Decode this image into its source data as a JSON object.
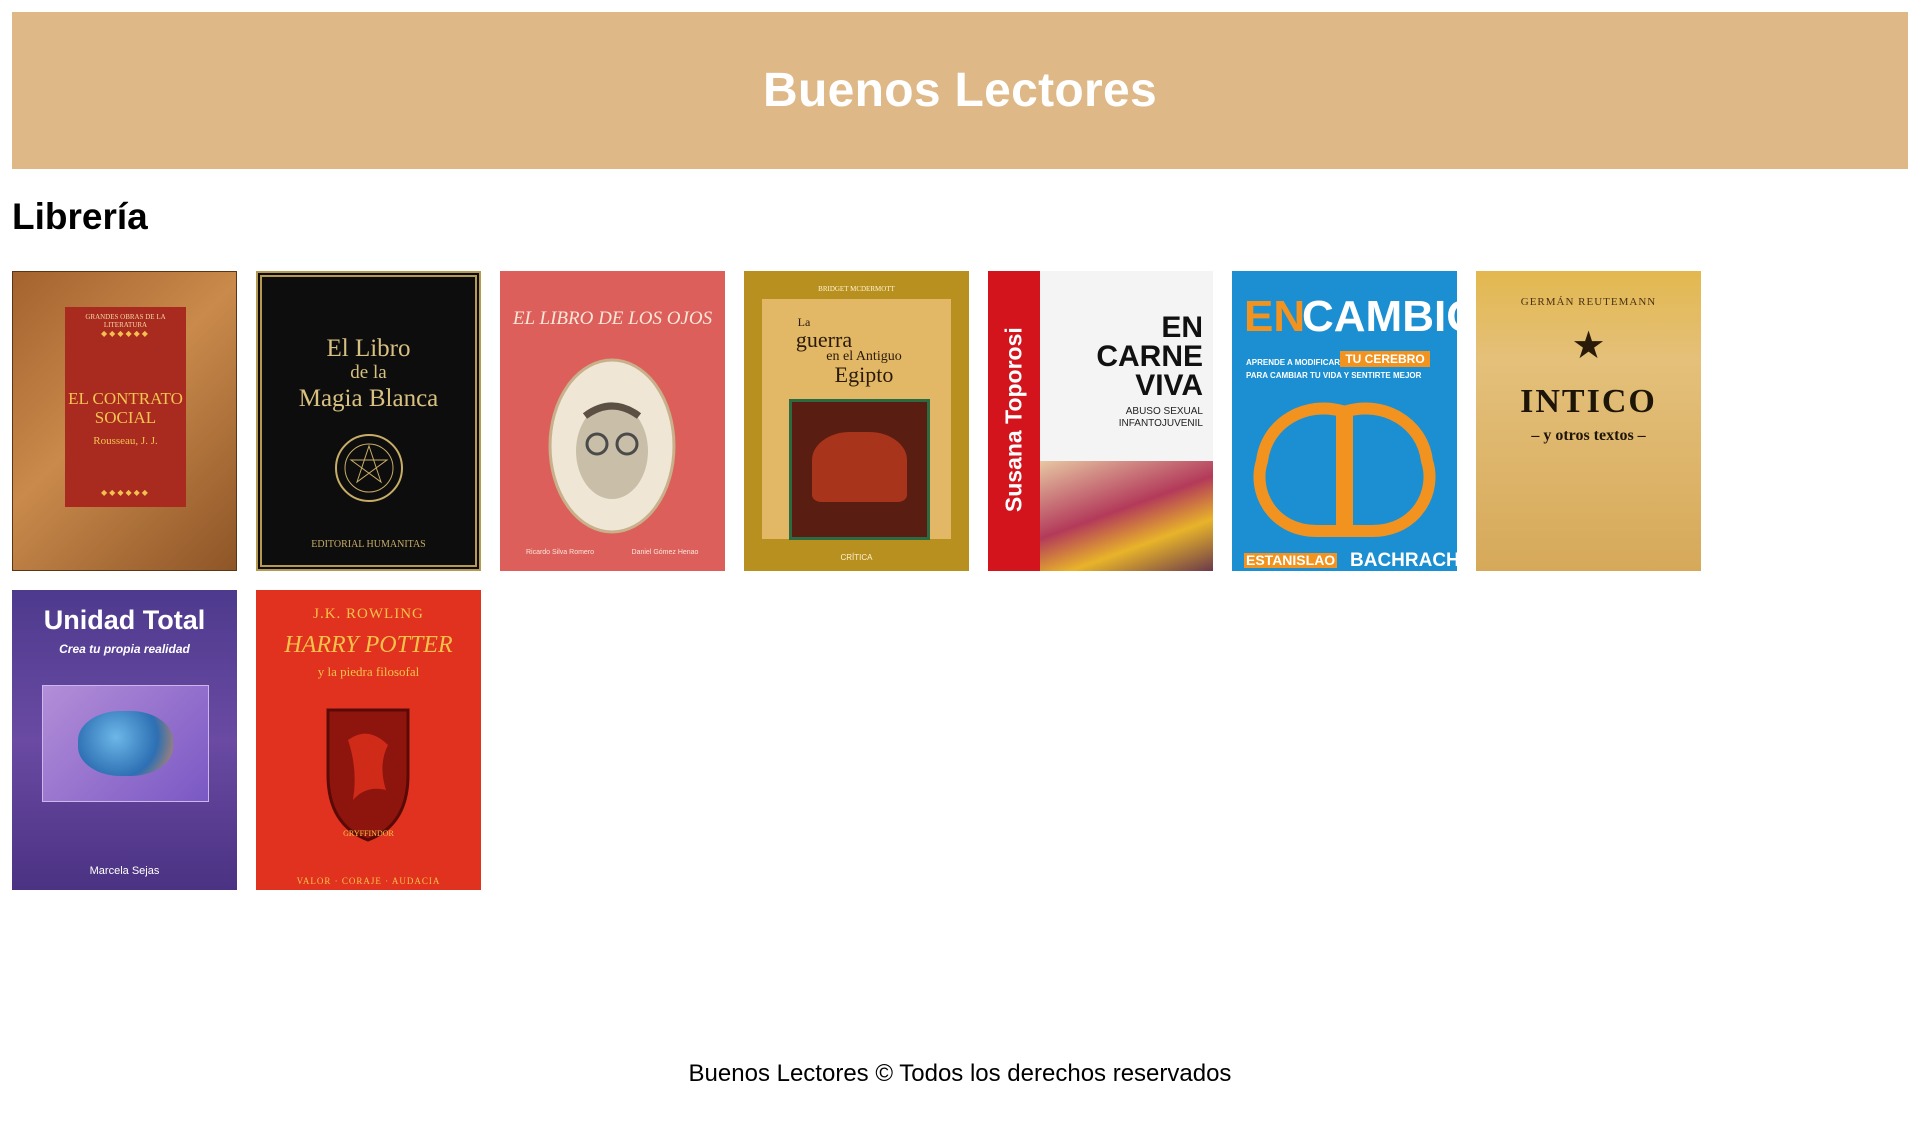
{
  "header": {
    "title": "Buenos Lectores"
  },
  "section": {
    "title": "Librería"
  },
  "books": [
    {
      "series": "GRANDES OBRAS DE LA LITERATURA",
      "title_line1": "EL CONTRATO",
      "title_line2": "SOCIAL",
      "author": "Rousseau, J. J."
    },
    {
      "title_line1": "El Libro",
      "title_line2": "de la",
      "title_line3": "Magia Blanca",
      "publisher": "EDITORIAL HUMANITAS"
    },
    {
      "title": "EL LIBRO DE LOS OJOS",
      "credit_left": "Ricardo Silva Romero",
      "credit_right": "Daniel Gómez Henao"
    },
    {
      "author": "BRIDGET MCDERMOTT",
      "title_line1": "La",
      "title_line2": "guerra",
      "title_line3": "en el Antiguo",
      "title_line4": "Egipto",
      "publisher": "CRÍTICA"
    },
    {
      "author": "Susana Toporosi",
      "title_line1": "EN",
      "title_line2": "CARNE",
      "title_line3": "VIVA",
      "subtitle_line1": "ABUSO SEXUAL",
      "subtitle_line2": "INFANTOJUVENIL"
    },
    {
      "title_part1": "EN",
      "title_part2": "CAMBIO",
      "sub1": "APRENDE A MODIFICAR",
      "sub2": "TU CEREBRO",
      "sub3": "PARA CAMBIAR TU VIDA Y SENTIRTE MEJOR",
      "author_first": "ESTANISLAO",
      "author_last": "BACHRACH"
    },
    {
      "author": "GERMÁN REUTEMANN",
      "title": "INTICO",
      "subtitle": "– y otros textos –"
    },
    {
      "title": "Unidad Total",
      "subtitle": "Crea tu propia realidad",
      "author": "Marcela Sejas"
    },
    {
      "author": "J.K. ROWLING",
      "title": "HARRY POTTER",
      "subtitle": "y la piedra filosofal",
      "house": "GRYFFINDOR",
      "motto": "VALOR · CORAJE · AUDACIA"
    }
  ],
  "footer": {
    "text": "Buenos Lectores © Todos los derechos reservados"
  }
}
